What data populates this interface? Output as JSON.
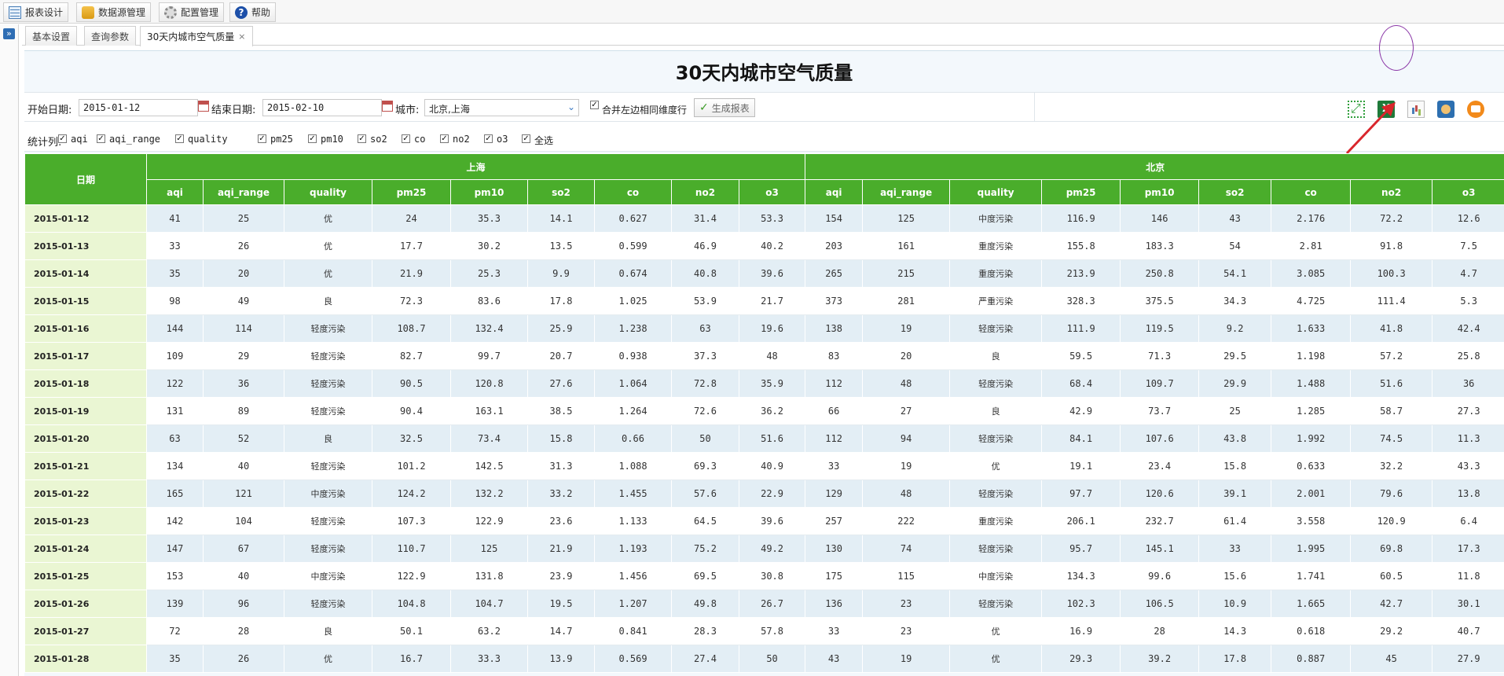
{
  "menu": [
    {
      "label": "报表设计",
      "icon": "report-design-icon"
    },
    {
      "label": "数据源管理",
      "icon": "database-icon"
    },
    {
      "label": "配置管理",
      "icon": "gear-icon"
    },
    {
      "label": "帮助",
      "icon": "help-icon"
    }
  ],
  "tabs": [
    {
      "label": "基本设置"
    },
    {
      "label": "查询参数"
    },
    {
      "label": "30天内城市空气质量",
      "close": "×"
    }
  ],
  "report": {
    "title": "30天内城市空气质量",
    "start_label": "开始日期:",
    "start_value": "2015-01-12",
    "end_label": "结束日期:",
    "end_value": "2015-02-10",
    "city_label": "城市:",
    "city_value": "北京,上海",
    "merge_label": "合并左边相同维度行",
    "generate_label": "生成报表",
    "stats_label": "统计列:",
    "stat_items": [
      "aqi",
      "aqi_range",
      "quality",
      "pm25",
      "pm10",
      "so2",
      "co",
      "no2",
      "o3",
      "全选"
    ]
  },
  "table": {
    "date_header": "日期",
    "groups": [
      "上海",
      "北京"
    ],
    "columns": [
      "aqi",
      "aqi_range",
      "quality",
      "pm25",
      "pm10",
      "so2",
      "co",
      "no2",
      "o3"
    ],
    "rows": [
      {
        "date": "2015-01-12",
        "shanghai": [
          "41",
          "25",
          "优",
          "24",
          "35.3",
          "14.1",
          "0.627",
          "31.4",
          "53.3"
        ],
        "beijing": [
          "154",
          "125",
          "中度污染",
          "116.9",
          "146",
          "43",
          "2.176",
          "72.2",
          "12.6"
        ]
      },
      {
        "date": "2015-01-13",
        "shanghai": [
          "33",
          "26",
          "优",
          "17.7",
          "30.2",
          "13.5",
          "0.599",
          "46.9",
          "40.2"
        ],
        "beijing": [
          "203",
          "161",
          "重度污染",
          "155.8",
          "183.3",
          "54",
          "2.81",
          "91.8",
          "7.5"
        ]
      },
      {
        "date": "2015-01-14",
        "shanghai": [
          "35",
          "20",
          "优",
          "21.9",
          "25.3",
          "9.9",
          "0.674",
          "40.8",
          "39.6"
        ],
        "beijing": [
          "265",
          "215",
          "重度污染",
          "213.9",
          "250.8",
          "54.1",
          "3.085",
          "100.3",
          "4.7"
        ]
      },
      {
        "date": "2015-01-15",
        "shanghai": [
          "98",
          "49",
          "良",
          "72.3",
          "83.6",
          "17.8",
          "1.025",
          "53.9",
          "21.7"
        ],
        "beijing": [
          "373",
          "281",
          "严重污染",
          "328.3",
          "375.5",
          "34.3",
          "4.725",
          "111.4",
          "5.3"
        ]
      },
      {
        "date": "2015-01-16",
        "shanghai": [
          "144",
          "114",
          "轻度污染",
          "108.7",
          "132.4",
          "25.9",
          "1.238",
          "63",
          "19.6"
        ],
        "beijing": [
          "138",
          "19",
          "轻度污染",
          "111.9",
          "119.5",
          "9.2",
          "1.633",
          "41.8",
          "42.4"
        ]
      },
      {
        "date": "2015-01-17",
        "shanghai": [
          "109",
          "29",
          "轻度污染",
          "82.7",
          "99.7",
          "20.7",
          "0.938",
          "37.3",
          "48"
        ],
        "beijing": [
          "83",
          "20",
          "良",
          "59.5",
          "71.3",
          "29.5",
          "1.198",
          "57.2",
          "25.8"
        ]
      },
      {
        "date": "2015-01-18",
        "shanghai": [
          "122",
          "36",
          "轻度污染",
          "90.5",
          "120.8",
          "27.6",
          "1.064",
          "72.8",
          "35.9"
        ],
        "beijing": [
          "112",
          "48",
          "轻度污染",
          "68.4",
          "109.7",
          "29.9",
          "1.488",
          "51.6",
          "36"
        ]
      },
      {
        "date": "2015-01-19",
        "shanghai": [
          "131",
          "89",
          "轻度污染",
          "90.4",
          "163.1",
          "38.5",
          "1.264",
          "72.6",
          "36.2"
        ],
        "beijing": [
          "66",
          "27",
          "良",
          "42.9",
          "73.7",
          "25",
          "1.285",
          "58.7",
          "27.3"
        ]
      },
      {
        "date": "2015-01-20",
        "shanghai": [
          "63",
          "52",
          "良",
          "32.5",
          "73.4",
          "15.8",
          "0.66",
          "50",
          "51.6"
        ],
        "beijing": [
          "112",
          "94",
          "轻度污染",
          "84.1",
          "107.6",
          "43.8",
          "1.992",
          "74.5",
          "11.3"
        ]
      },
      {
        "date": "2015-01-21",
        "shanghai": [
          "134",
          "40",
          "轻度污染",
          "101.2",
          "142.5",
          "31.3",
          "1.088",
          "69.3",
          "40.9"
        ],
        "beijing": [
          "33",
          "19",
          "优",
          "19.1",
          "23.4",
          "15.8",
          "0.633",
          "32.2",
          "43.3"
        ]
      },
      {
        "date": "2015-01-22",
        "shanghai": [
          "165",
          "121",
          "中度污染",
          "124.2",
          "132.2",
          "33.2",
          "1.455",
          "57.6",
          "22.9"
        ],
        "beijing": [
          "129",
          "48",
          "轻度污染",
          "97.7",
          "120.6",
          "39.1",
          "2.001",
          "79.6",
          "13.8"
        ]
      },
      {
        "date": "2015-01-23",
        "shanghai": [
          "142",
          "104",
          "轻度污染",
          "107.3",
          "122.9",
          "23.6",
          "1.133",
          "64.5",
          "39.6"
        ],
        "beijing": [
          "257",
          "222",
          "重度污染",
          "206.1",
          "232.7",
          "61.4",
          "3.558",
          "120.9",
          "6.4"
        ]
      },
      {
        "date": "2015-01-24",
        "shanghai": [
          "147",
          "67",
          "轻度污染",
          "110.7",
          "125",
          "21.9",
          "1.193",
          "75.2",
          "49.2"
        ],
        "beijing": [
          "130",
          "74",
          "轻度污染",
          "95.7",
          "145.1",
          "33",
          "1.995",
          "69.8",
          "17.3"
        ]
      },
      {
        "date": "2015-01-25",
        "shanghai": [
          "153",
          "40",
          "中度污染",
          "122.9",
          "131.8",
          "23.9",
          "1.456",
          "69.5",
          "30.8"
        ],
        "beijing": [
          "175",
          "115",
          "中度污染",
          "134.3",
          "99.6",
          "15.6",
          "1.741",
          "60.5",
          "11.8"
        ]
      },
      {
        "date": "2015-01-26",
        "shanghai": [
          "139",
          "96",
          "轻度污染",
          "104.8",
          "104.7",
          "19.5",
          "1.207",
          "49.8",
          "26.7"
        ],
        "beijing": [
          "136",
          "23",
          "轻度污染",
          "102.3",
          "106.5",
          "10.9",
          "1.665",
          "42.7",
          "30.1"
        ]
      },
      {
        "date": "2015-01-27",
        "shanghai": [
          "72",
          "28",
          "良",
          "50.1",
          "63.2",
          "14.7",
          "0.841",
          "28.3",
          "57.8"
        ],
        "beijing": [
          "33",
          "23",
          "优",
          "16.9",
          "28",
          "14.3",
          "0.618",
          "29.2",
          "40.7"
        ]
      },
      {
        "date": "2015-01-28",
        "shanghai": [
          "35",
          "26",
          "优",
          "16.7",
          "33.3",
          "13.9",
          "0.569",
          "27.4",
          "50"
        ],
        "beijing": [
          "43",
          "19",
          "优",
          "29.3",
          "39.2",
          "17.8",
          "0.887",
          "45",
          "27.9"
        ]
      }
    ]
  },
  "colors": {
    "header_green": "#4aad2b",
    "date_cell": "#eaf6d3",
    "row_stripe": "#e3eef5",
    "annotation": "#d9262c",
    "highlight": "#8c3aa8"
  }
}
